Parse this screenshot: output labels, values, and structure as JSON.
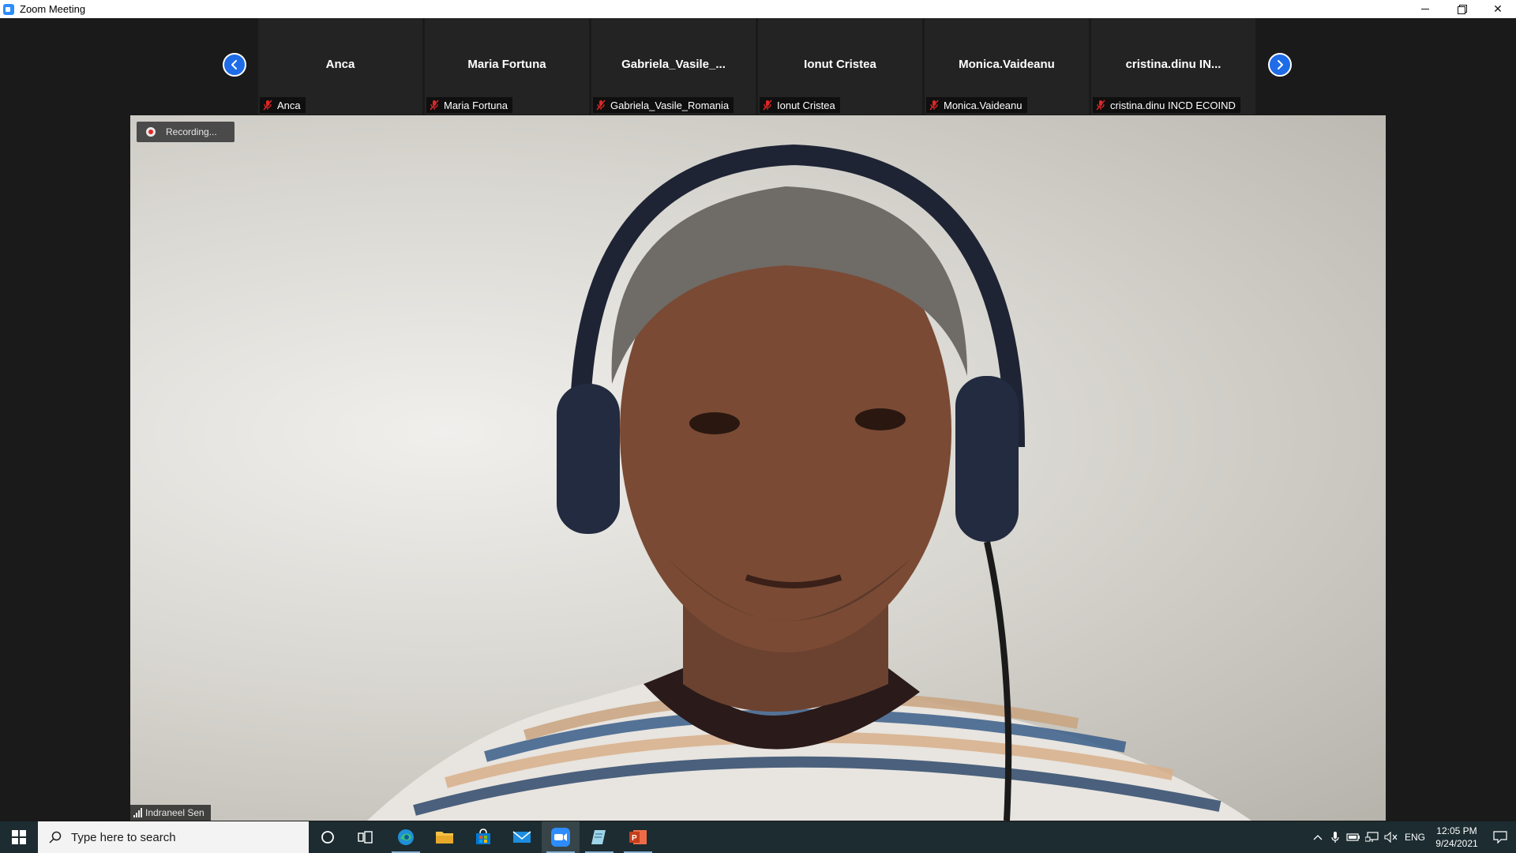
{
  "window": {
    "title": "Zoom Meeting"
  },
  "gallery": {
    "participants": [
      {
        "display_name": "Anca",
        "label": "Anca"
      },
      {
        "display_name": "Maria Fortuna",
        "label": "Maria Fortuna"
      },
      {
        "display_name": "Gabriela_Vasile_...",
        "label": "Gabriela_Vasile_Romania"
      },
      {
        "display_name": "Ionut Cristea",
        "label": "Ionut Cristea"
      },
      {
        "display_name": "Monica.Vaideanu",
        "label": "Monica.Vaideanu"
      },
      {
        "display_name": "cristina.dinu  IN...",
        "label": "cristina.dinu INCD ECOIND"
      }
    ]
  },
  "main_video": {
    "recording_label": "Recording...",
    "speaker_name": "Indraneel Sen"
  },
  "taskbar": {
    "search_placeholder": "Type here to search",
    "language": "ENG",
    "time": "12:05 PM",
    "date": "9/24/2021"
  },
  "colors": {
    "zoom_blue": "#2d8cff",
    "nav_button": "#1e6ce8",
    "mute_red": "#e02828",
    "taskbar_bg": "#1c2c30"
  },
  "icons": {
    "app": "zoom-app-icon",
    "prev": "chevron-left-icon",
    "next": "chevron-right-icon",
    "muted": "mic-muted-icon",
    "signal": "signal-strength-icon"
  }
}
